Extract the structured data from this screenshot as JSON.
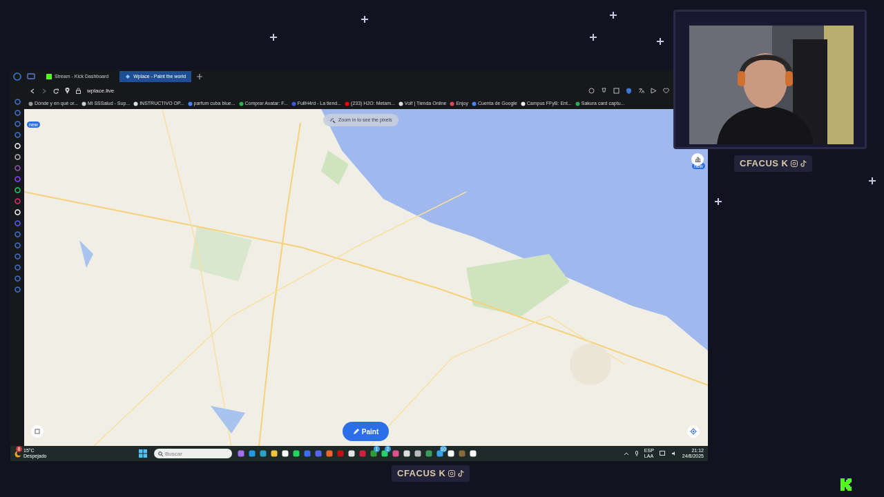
{
  "browser": {
    "tabs": [
      {
        "label": "Stream - Kick Dashboard",
        "selected": false
      },
      {
        "label": "Wplace - Paint the world",
        "selected": true
      }
    ],
    "address": "wplace.live",
    "bookmarks": [
      "Dónde y en qué or...",
      "Mi SSSalud - Sup...",
      "INSTRUCTIVO OP...",
      "parfum cuba blue...",
      "Comprar Avatar: F...",
      "FullH4rd - La tiend...",
      "(233) H2O: Metam...",
      "Volf | Tienda Online",
      "Enjoy",
      "Cuenta de Google",
      "Campus FFyB: Ent...",
      "Sakura card captu..."
    ]
  },
  "map": {
    "hint": "Zoom in to see the pixels",
    "paint_button": "Paint",
    "badges": [
      "new",
      "new"
    ]
  },
  "taskbar": {
    "temperature": "15°C",
    "weather": "Despejado",
    "weather_badge": "8",
    "search_placeholder": "Buscar",
    "app_badges": [
      "1",
      "2",
      "10"
    ],
    "language": "ESP",
    "layout": "LAA",
    "time": "21:12",
    "date": "24/8/2025"
  },
  "overlay": {
    "labels": [
      "CFACUS K",
      "CFACUS K"
    ]
  }
}
